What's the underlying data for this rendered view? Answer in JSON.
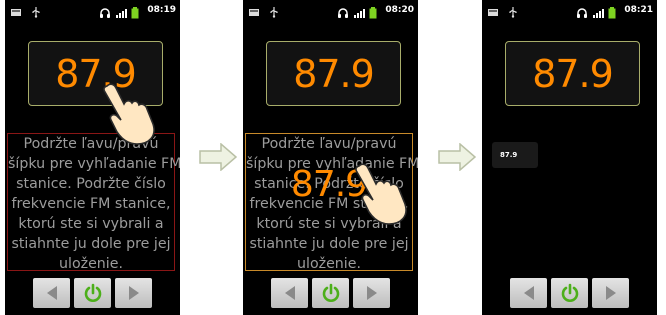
{
  "screens": [
    {
      "time": "08:19",
      "frequency": "87.9",
      "help_lines": [
        "Podržte ľavu/pravú",
        "šípku pre vyhľadanie FM",
        "stanice. Podržte číslo",
        "frekvencie FM stanice,",
        "ktorú ste si vybrali a",
        "stiahnte ju dole pre jej",
        "uloženie."
      ]
    },
    {
      "time": "08:20",
      "frequency": "87.9",
      "dragged_frequency": "87.9",
      "help_lines": [
        "Podržte ľavu/pravú",
        "šípku pre vyhľadanie FM",
        "stanice. Podržte číslo",
        "frekvencie FM stanice,",
        "ktorú ste si vybrali a",
        "stiahnte ju dole pre jej",
        "uloženie."
      ]
    },
    {
      "time": "08:21",
      "frequency": "87.9",
      "saved_station": "87.9"
    }
  ],
  "colors": {
    "frequency": "#ff8a00",
    "help_text": "#9c9c9c",
    "power_icon": "#4caf1a",
    "battery": "#7ed321"
  },
  "icons": {
    "status_left": [
      "sd-card-icon",
      "usb-icon"
    ],
    "status_right": [
      "headphones-icon",
      "signal-icon",
      "battery-icon"
    ],
    "controls": [
      "seek-left-icon",
      "power-icon",
      "seek-right-icon"
    ],
    "gesture": "hand-pointer-icon",
    "step": "next-step-arrow-icon"
  }
}
